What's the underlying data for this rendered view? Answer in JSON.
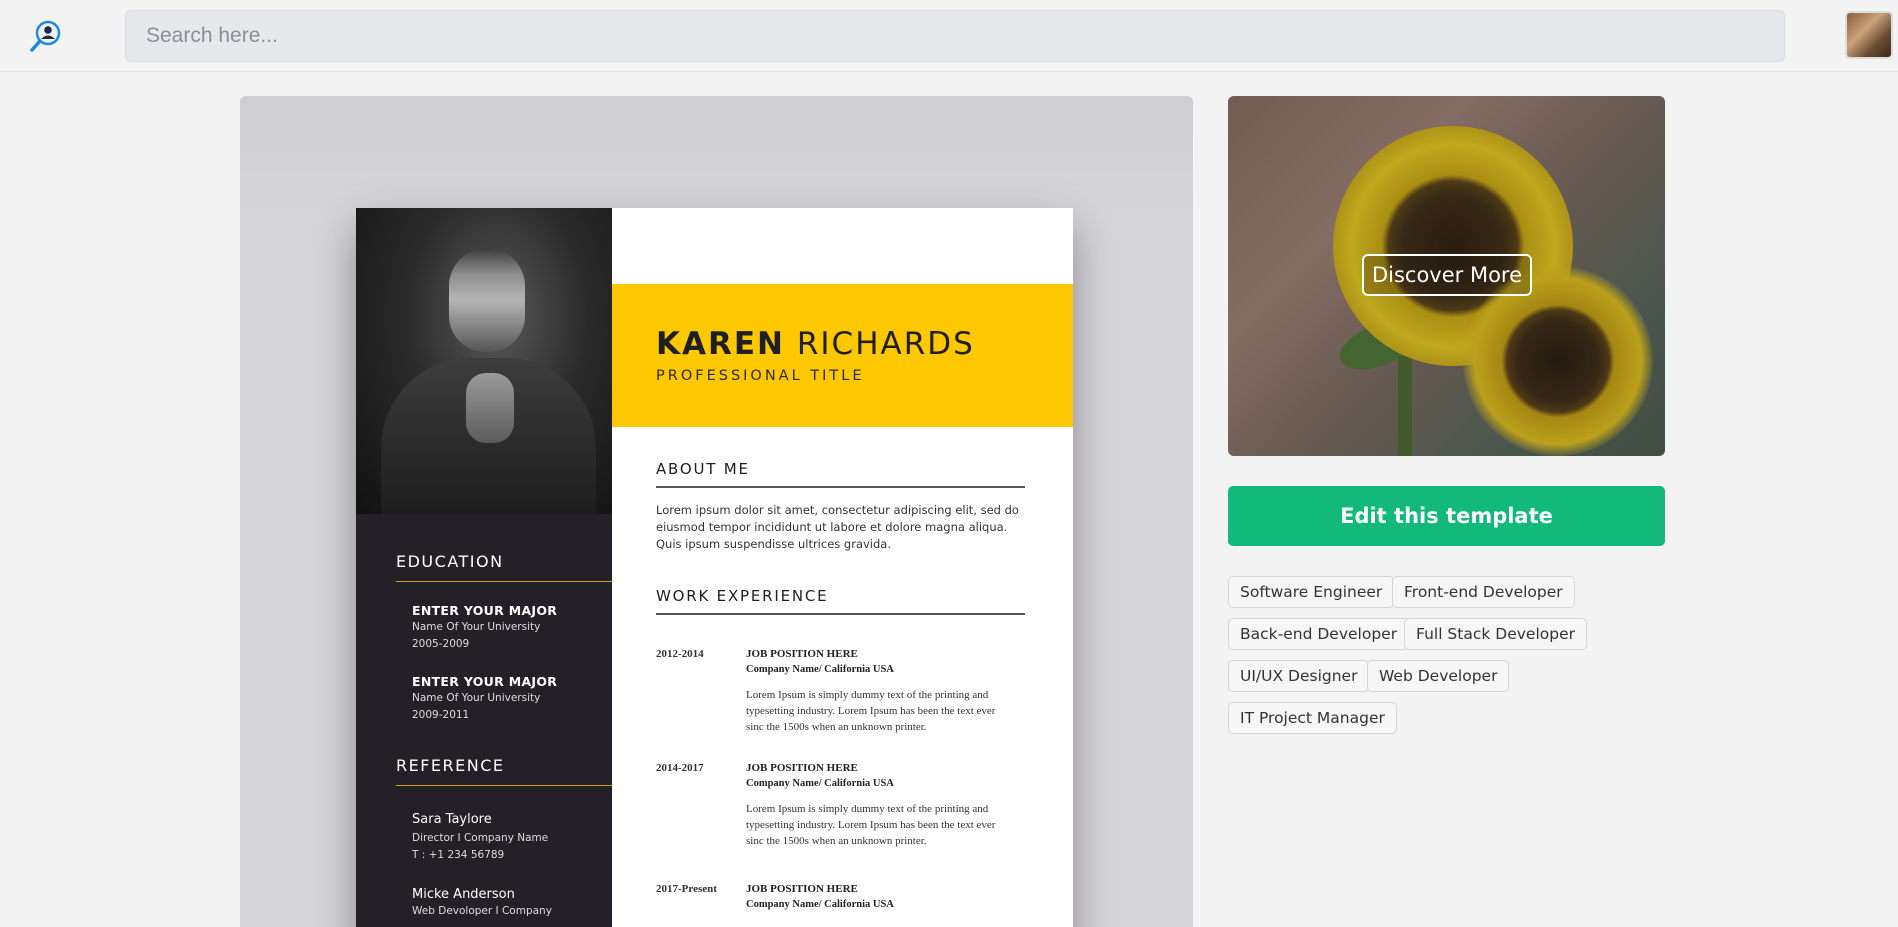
{
  "search": {
    "placeholder": "Search here..."
  },
  "resume": {
    "first_name": "KAREN",
    "last_name": "RICHARDS",
    "professional_title": "PROFESSIONAL TITLE",
    "education_heading": "EDUCATION",
    "education": [
      {
        "major": "ENTER YOUR MAJOR",
        "university": "Name Of Your University",
        "years": "2005-2009"
      },
      {
        "major": "ENTER YOUR MAJOR",
        "university": "Name Of Your University",
        "years": "2009-2011"
      }
    ],
    "reference_heading": "REFERENCE",
    "references": [
      {
        "name": "Sara Taylore",
        "role": "Director I Company Name",
        "phone": "T : +1 234 56789"
      },
      {
        "name": "Micke Anderson",
        "role": "Web Devoloper I Company",
        "phone": ""
      }
    ],
    "about_heading": "ABOUT ME",
    "about_text": "Lorem ipsum dolor sit amet, consectetur adipiscing elit, sed do eiusmod tempor incididunt ut labore et dolore magna aliqua. Quis ipsum suspendisse ultrices gravida.",
    "work_heading": "WORK EXPERIENCE",
    "jobs": [
      {
        "years": "2012-2014",
        "position": "JOB POSITION HERE",
        "company": "Company Name/ California USA",
        "description": "Lorem Ipsum is simply dummy text of the printing and typesetting industry. Lorem Ipsum has been the text ever sinc the 1500s when an unknown printer."
      },
      {
        "years": "2014-2017",
        "position": "JOB POSITION HERE",
        "company": "Company Name/ California USA",
        "description": "Lorem Ipsum is simply dummy text of the printing and typesetting industry. Lorem Ipsum has been the text ever sinc the 1500s when an unknown printer."
      },
      {
        "years": "2017-Present",
        "position": "JOB POSITION HERE",
        "company": "Company Name/ California USA",
        "description": ""
      }
    ]
  },
  "sidebar": {
    "discover_label": "Discover More",
    "edit_label": "Edit this template",
    "tags": [
      "Software Engineer",
      "Front-end Developer",
      "Back-end Developer",
      "Full Stack Developer",
      "UI/UX Designer",
      "Web Developer",
      "IT Project Manager"
    ]
  },
  "colors": {
    "accent_green": "#12b97a",
    "resume_yellow": "#fec800",
    "resume_dark": "#232127",
    "logo_blue": "#1e88e5"
  },
  "icons": {
    "logo": "user-search-icon",
    "avatar": "user-avatar"
  }
}
